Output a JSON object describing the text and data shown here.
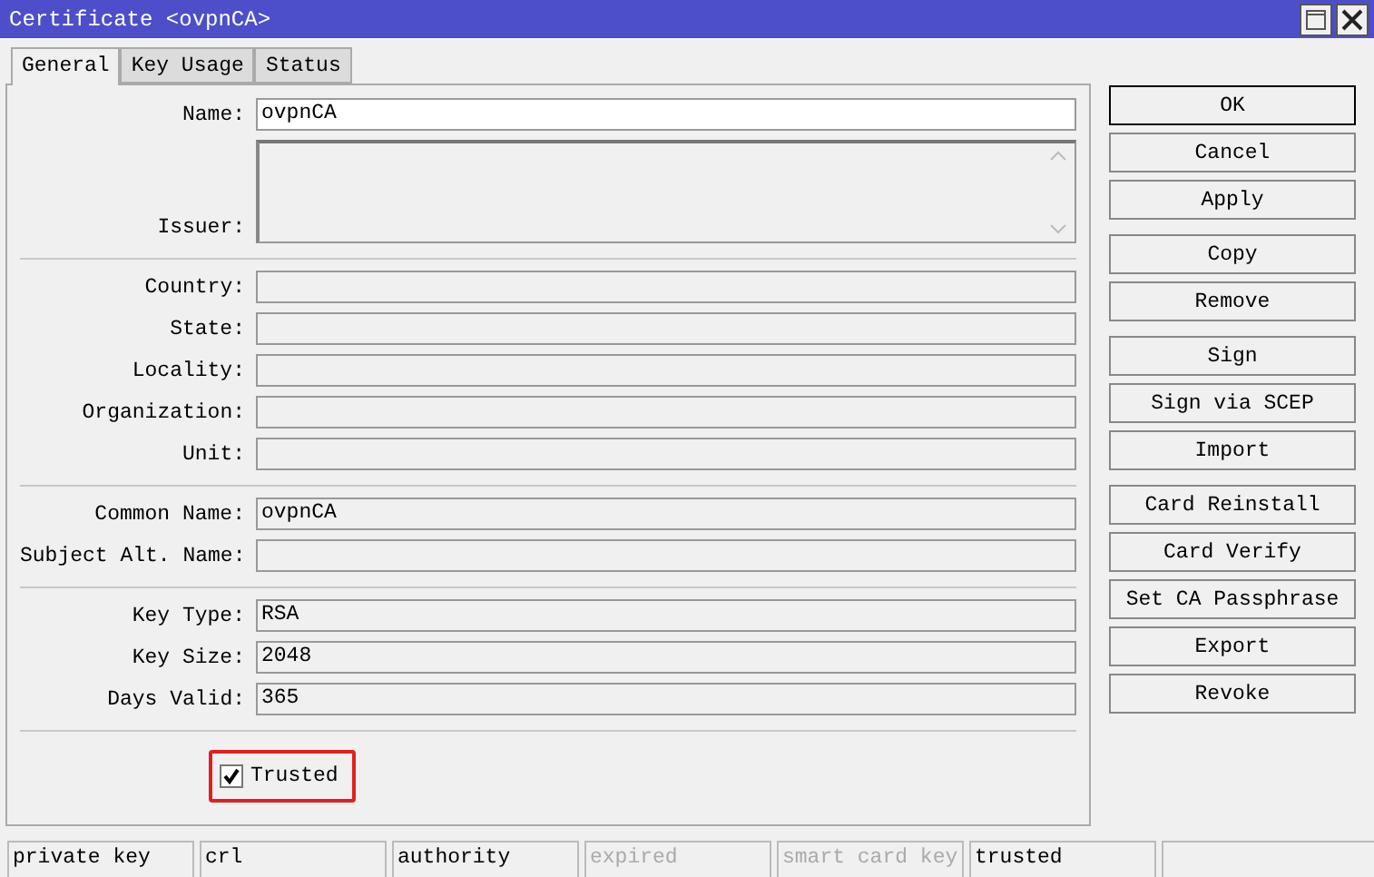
{
  "window": {
    "title": "Certificate <ovpnCA>"
  },
  "tabs": [
    {
      "label": "General",
      "selected": true
    },
    {
      "label": "Key Usage",
      "selected": false
    },
    {
      "label": "Status",
      "selected": false
    }
  ],
  "field_groups": [
    [
      {
        "kind": "text",
        "label": "Name:",
        "value": "ovpnCA",
        "editable": true
      },
      {
        "kind": "area",
        "label": "Issuer:"
      }
    ],
    [
      {
        "kind": "text",
        "label": "Country:"
      },
      {
        "kind": "text",
        "label": "State:"
      },
      {
        "kind": "text",
        "label": "Locality:"
      },
      {
        "kind": "text",
        "label": "Organization:"
      },
      {
        "kind": "text",
        "label": "Unit:"
      }
    ],
    [
      {
        "kind": "text",
        "label": "Common Name:",
        "value": "ovpnCA"
      },
      {
        "kind": "text",
        "label": "Subject Alt. Name:"
      }
    ],
    [
      {
        "kind": "text",
        "label": "Key Type:",
        "value": "RSA"
      },
      {
        "kind": "text",
        "label": "Key Size:",
        "value": "2048"
      },
      {
        "kind": "text",
        "label": "Days Valid:",
        "value": "365"
      }
    ]
  ],
  "trusted": {
    "label": "Trusted",
    "checked": true,
    "highlighted": true
  },
  "button_groups": [
    [
      {
        "label": "OK",
        "default": true
      },
      {
        "label": "Cancel",
        "default": false
      },
      {
        "label": "Apply",
        "default": false
      }
    ],
    [
      {
        "label": "Copy",
        "default": false
      },
      {
        "label": "Remove",
        "default": false
      }
    ],
    [
      {
        "label": "Sign",
        "default": false
      },
      {
        "label": "Sign via SCEP",
        "default": false
      },
      {
        "label": "Import",
        "default": false
      }
    ],
    [
      {
        "label": "Card Reinstall",
        "default": false
      },
      {
        "label": "Card Verify",
        "default": false
      },
      {
        "label": "Set CA Passphrase",
        "default": false
      },
      {
        "label": "Export",
        "default": false
      },
      {
        "label": "Revoke",
        "default": false
      }
    ]
  ],
  "status_bar": [
    {
      "text": "private key",
      "disabled": false
    },
    {
      "text": "crl",
      "disabled": false
    },
    {
      "text": "authority",
      "disabled": false
    },
    {
      "text": "expired",
      "disabled": true
    },
    {
      "text": "smart card key",
      "disabled": true
    },
    {
      "text": "trusted",
      "disabled": false
    }
  ]
}
